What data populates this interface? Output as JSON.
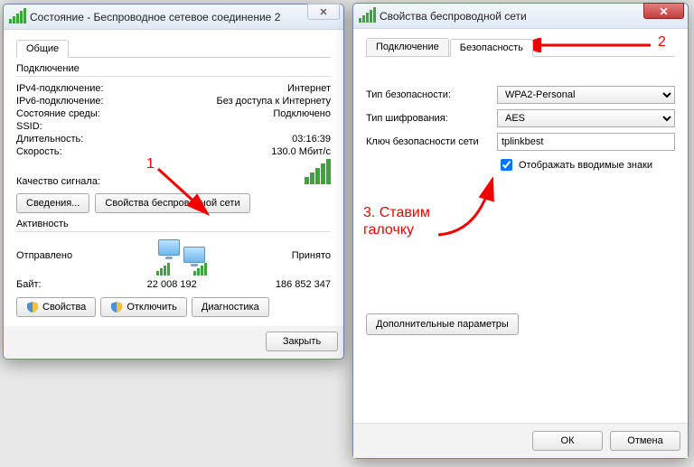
{
  "left": {
    "title": "Состояние - Беспроводное сетевое соединение 2",
    "tab_general": "Общие",
    "section_connection": "Подключение",
    "rows": {
      "ipv4_label": "IPv4-подключение:",
      "ipv4_value": "Интернет",
      "ipv6_label": "IPv6-подключение:",
      "ipv6_value": "Без доступа к Интернету",
      "media_label": "Состояние среды:",
      "media_value": "Подключено",
      "ssid_label": "SSID:",
      "ssid_value": "",
      "duration_label": "Длительность:",
      "duration_value": "03:16:39",
      "speed_label": "Скорость:",
      "speed_value": "130.0 Мбит/с",
      "signal_label": "Качество сигнала:"
    },
    "btn_details": "Сведения...",
    "btn_wifi_props": "Свойства беспроводной сети",
    "section_activity": "Активность",
    "sent": "Отправлено",
    "received": "Принято",
    "bytes_label": "Байт:",
    "sent_bytes": "22 008 192",
    "recv_bytes": "186 852 347",
    "btn_properties": "Свойства",
    "btn_disable": "Отключить",
    "btn_diagnose": "Диагностика",
    "btn_close": "Закрыть"
  },
  "right": {
    "title": "Свойства беспроводной сети",
    "tab_connection": "Подключение",
    "tab_security": "Безопасность",
    "labels": {
      "sec_type": "Тип безопасности:",
      "enc_type": "Тип шифрования:",
      "net_key": "Ключ безопасности сети"
    },
    "values": {
      "sec_type": "WPA2-Personal",
      "enc_type": "AES",
      "net_key": "tplinkbest"
    },
    "show_chars": "Отображать вводимые знаки",
    "btn_advanced": "Дополнительные параметры",
    "btn_ok": "ОК",
    "btn_cancel": "Отмена"
  },
  "annotations": {
    "n1": "1",
    "n2": "2",
    "n3_line1": "3. Ставим",
    "n3_line2": "галочку"
  }
}
